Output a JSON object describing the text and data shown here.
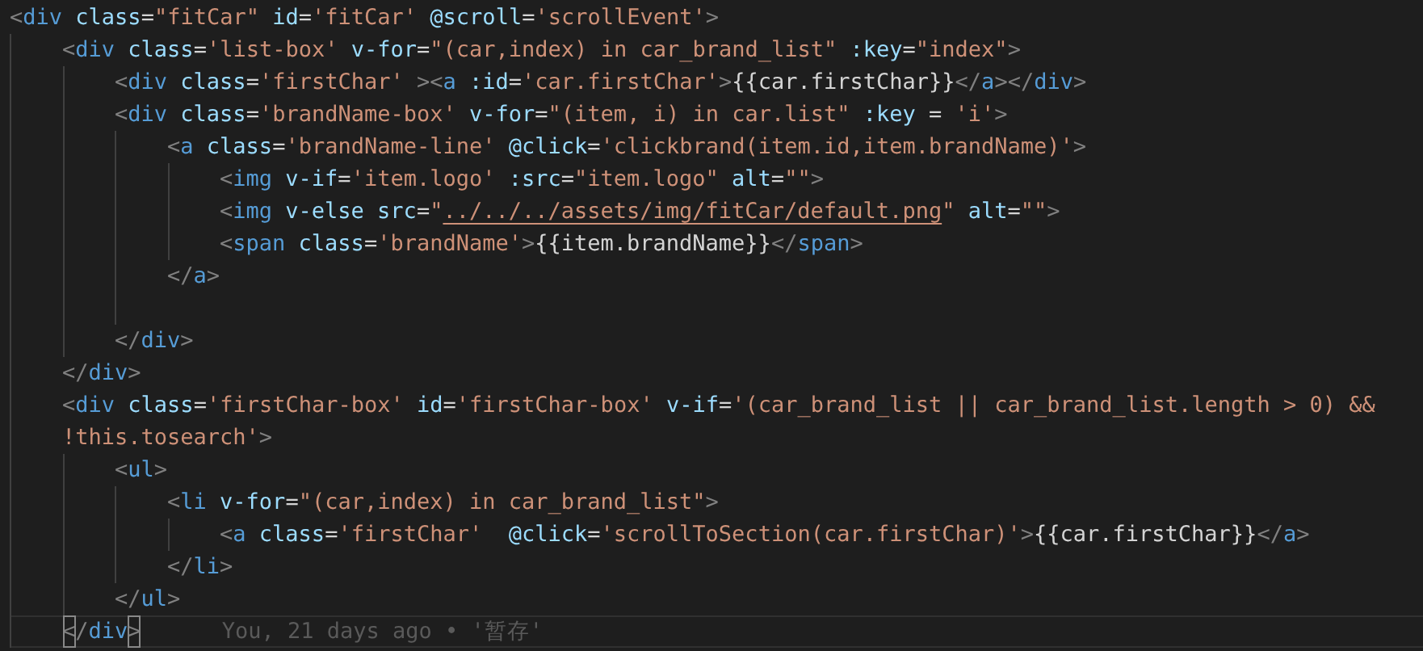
{
  "editor": {
    "lines": [
      {
        "tokens": [
          {
            "kind": "punct",
            "text": "<"
          },
          {
            "kind": "tag",
            "text": "div"
          },
          {
            "kind": "attr",
            "text": " class"
          },
          {
            "kind": "text",
            "text": "="
          },
          {
            "kind": "string",
            "text": "\"fitCar\""
          },
          {
            "kind": "attr",
            "text": " id"
          },
          {
            "kind": "text",
            "text": "="
          },
          {
            "kind": "string",
            "text": "'fitCar'"
          },
          {
            "kind": "attr",
            "text": " @scroll"
          },
          {
            "kind": "text",
            "text": "="
          },
          {
            "kind": "string",
            "text": "'scrollEvent'"
          },
          {
            "kind": "punct",
            "text": ">"
          }
        ],
        "children": [
          {
            "tokens": [
              {
                "kind": "punct",
                "text": "<"
              },
              {
                "kind": "tag",
                "text": "div"
              },
              {
                "kind": "attr",
                "text": " class"
              },
              {
                "kind": "text",
                "text": "="
              },
              {
                "kind": "string",
                "text": "'list-box'"
              },
              {
                "kind": "attr",
                "text": " v-for"
              },
              {
                "kind": "text",
                "text": "="
              },
              {
                "kind": "string",
                "text": "\"(car,index) in car_brand_list\""
              },
              {
                "kind": "attr",
                "text": " :key"
              },
              {
                "kind": "text",
                "text": "="
              },
              {
                "kind": "string",
                "text": "\"index\""
              },
              {
                "kind": "punct",
                "text": ">"
              }
            ],
            "children": [
              {
                "tokens": [
                  {
                    "kind": "punct",
                    "text": "<"
                  },
                  {
                    "kind": "tag",
                    "text": "div"
                  },
                  {
                    "kind": "attr",
                    "text": " class"
                  },
                  {
                    "kind": "text",
                    "text": "="
                  },
                  {
                    "kind": "string",
                    "text": "'firstChar'"
                  },
                  {
                    "kind": "punct",
                    "text": " ><"
                  },
                  {
                    "kind": "tag",
                    "text": "a"
                  },
                  {
                    "kind": "attr",
                    "text": " :id"
                  },
                  {
                    "kind": "text",
                    "text": "="
                  },
                  {
                    "kind": "string",
                    "text": "'car.firstChar'"
                  },
                  {
                    "kind": "punct",
                    "text": ">"
                  },
                  {
                    "kind": "text",
                    "text": "{{car.firstChar}}"
                  },
                  {
                    "kind": "punct",
                    "text": "</"
                  },
                  {
                    "kind": "tag",
                    "text": "a"
                  },
                  {
                    "kind": "punct",
                    "text": "></"
                  },
                  {
                    "kind": "tag",
                    "text": "div"
                  },
                  {
                    "kind": "punct",
                    "text": ">"
                  }
                ]
              },
              {
                "tokens": [
                  {
                    "kind": "punct",
                    "text": "<"
                  },
                  {
                    "kind": "tag",
                    "text": "div"
                  },
                  {
                    "kind": "attr",
                    "text": " class"
                  },
                  {
                    "kind": "text",
                    "text": "="
                  },
                  {
                    "kind": "string",
                    "text": "'brandName-box'"
                  },
                  {
                    "kind": "attr",
                    "text": " v-for"
                  },
                  {
                    "kind": "text",
                    "text": "="
                  },
                  {
                    "kind": "string",
                    "text": "\"(item, i) in car.list\""
                  },
                  {
                    "kind": "attr",
                    "text": " :key"
                  },
                  {
                    "kind": "text",
                    "text": " = "
                  },
                  {
                    "kind": "string",
                    "text": "'i'"
                  },
                  {
                    "kind": "punct",
                    "text": ">"
                  }
                ],
                "children": [
                  {
                    "tokens": [
                      {
                        "kind": "punct",
                        "text": "<"
                      },
                      {
                        "kind": "tag",
                        "text": "a"
                      },
                      {
                        "kind": "attr",
                        "text": " class"
                      },
                      {
                        "kind": "text",
                        "text": "="
                      },
                      {
                        "kind": "string",
                        "text": "'brandName-line'"
                      },
                      {
                        "kind": "attr",
                        "text": " @click"
                      },
                      {
                        "kind": "text",
                        "text": "="
                      },
                      {
                        "kind": "string",
                        "text": "'clickbrand(item.id,item.brandName)'"
                      },
                      {
                        "kind": "punct",
                        "text": ">"
                      }
                    ],
                    "children": [
                      {
                        "tokens": [
                          {
                            "kind": "punct",
                            "text": "<"
                          },
                          {
                            "kind": "tag",
                            "text": "img"
                          },
                          {
                            "kind": "attr",
                            "text": " v-if"
                          },
                          {
                            "kind": "text",
                            "text": "="
                          },
                          {
                            "kind": "string",
                            "text": "'item.logo'"
                          },
                          {
                            "kind": "attr",
                            "text": " :src"
                          },
                          {
                            "kind": "text",
                            "text": "="
                          },
                          {
                            "kind": "string",
                            "text": "\"item.logo\""
                          },
                          {
                            "kind": "attr",
                            "text": " alt"
                          },
                          {
                            "kind": "text",
                            "text": "="
                          },
                          {
                            "kind": "string",
                            "text": "\"\""
                          },
                          {
                            "kind": "punct",
                            "text": ">"
                          }
                        ]
                      },
                      {
                        "tokens": [
                          {
                            "kind": "punct",
                            "text": "<"
                          },
                          {
                            "kind": "tag",
                            "text": "img"
                          },
                          {
                            "kind": "attr",
                            "text": " v-else src"
                          },
                          {
                            "kind": "text",
                            "text": "="
                          },
                          {
                            "kind": "string",
                            "text": "\""
                          },
                          {
                            "kind": "string",
                            "text": "../../../assets/img/fitCar/default.png",
                            "underlined": true
                          },
                          {
                            "kind": "string",
                            "text": "\""
                          },
                          {
                            "kind": "attr",
                            "text": " alt"
                          },
                          {
                            "kind": "text",
                            "text": "="
                          },
                          {
                            "kind": "string",
                            "text": "\"\""
                          },
                          {
                            "kind": "punct",
                            "text": ">"
                          }
                        ]
                      },
                      {
                        "tokens": [
                          {
                            "kind": "punct",
                            "text": "<"
                          },
                          {
                            "kind": "tag",
                            "text": "span"
                          },
                          {
                            "kind": "attr",
                            "text": " class"
                          },
                          {
                            "kind": "text",
                            "text": "="
                          },
                          {
                            "kind": "string",
                            "text": "'brandName'"
                          },
                          {
                            "kind": "punct",
                            "text": ">"
                          },
                          {
                            "kind": "text",
                            "text": "{{item.brandName}}"
                          },
                          {
                            "kind": "punct",
                            "text": "</"
                          },
                          {
                            "kind": "tag",
                            "text": "span"
                          },
                          {
                            "kind": "punct",
                            "text": ">"
                          }
                        ]
                      }
                    ]
                  },
                  {
                    "tokens": [
                      {
                        "kind": "punct",
                        "text": "</"
                      },
                      {
                        "kind": "tag",
                        "text": "a"
                      },
                      {
                        "kind": "punct",
                        "text": ">"
                      }
                    ]
                  },
                  {
                    "blank": true
                  }
                ]
              },
              {
                "tokens": [
                  {
                    "kind": "punct",
                    "text": "</"
                  },
                  {
                    "kind": "tag",
                    "text": "div"
                  },
                  {
                    "kind": "punct",
                    "text": ">"
                  }
                ]
              }
            ]
          },
          {
            "tokens": [
              {
                "kind": "punct",
                "text": "</"
              },
              {
                "kind": "tag",
                "text": "div"
              },
              {
                "kind": "punct",
                "text": ">"
              }
            ]
          },
          {
            "tokens": [
              {
                "kind": "punct",
                "text": "<"
              },
              {
                "kind": "tag",
                "text": "div"
              },
              {
                "kind": "attr",
                "text": " class"
              },
              {
                "kind": "text",
                "text": "="
              },
              {
                "kind": "string",
                "text": "'firstChar-box'"
              },
              {
                "kind": "attr",
                "text": " id"
              },
              {
                "kind": "text",
                "text": "="
              },
              {
                "kind": "string",
                "text": "'firstChar-box'"
              },
              {
                "kind": "attr",
                "text": " v-if"
              },
              {
                "kind": "text",
                "text": "="
              },
              {
                "kind": "string",
                "text": "'(car_brand_list || car_brand_list.length > 0) &&"
              }
            ]
          },
          {
            "tokens": [
              {
                "kind": "string",
                "text": "!this.tosearch'"
              },
              {
                "kind": "punct",
                "text": ">"
              }
            ],
            "children": [
              {
                "tokens": [
                  {
                    "kind": "punct",
                    "text": "<"
                  },
                  {
                    "kind": "tag",
                    "text": "ul"
                  },
                  {
                    "kind": "punct",
                    "text": ">"
                  }
                ],
                "children": [
                  {
                    "tokens": [
                      {
                        "kind": "punct",
                        "text": "<"
                      },
                      {
                        "kind": "tag",
                        "text": "li"
                      },
                      {
                        "kind": "attr",
                        "text": " v-for"
                      },
                      {
                        "kind": "text",
                        "text": "="
                      },
                      {
                        "kind": "string",
                        "text": "\"(car,index) in car_brand_list\""
                      },
                      {
                        "kind": "punct",
                        "text": ">"
                      }
                    ],
                    "children": [
                      {
                        "tokens": [
                          {
                            "kind": "punct",
                            "text": "<"
                          },
                          {
                            "kind": "tag",
                            "text": "a"
                          },
                          {
                            "kind": "attr",
                            "text": " class"
                          },
                          {
                            "kind": "text",
                            "text": "="
                          },
                          {
                            "kind": "string",
                            "text": "'firstChar'"
                          },
                          {
                            "kind": "attr",
                            "text": "  @click"
                          },
                          {
                            "kind": "text",
                            "text": "="
                          },
                          {
                            "kind": "string",
                            "text": "'scrollToSection(car.firstChar)'"
                          },
                          {
                            "kind": "punct",
                            "text": ">"
                          },
                          {
                            "kind": "text",
                            "text": "{{car.firstChar}}"
                          },
                          {
                            "kind": "punct",
                            "text": "</"
                          },
                          {
                            "kind": "tag",
                            "text": "a"
                          },
                          {
                            "kind": "punct",
                            "text": ">"
                          }
                        ]
                      }
                    ]
                  },
                  {
                    "tokens": [
                      {
                        "kind": "punct",
                        "text": "</"
                      },
                      {
                        "kind": "tag",
                        "text": "li"
                      },
                      {
                        "kind": "punct",
                        "text": ">"
                      }
                    ]
                  }
                ]
              },
              {
                "tokens": [
                  {
                    "kind": "punct",
                    "text": "</"
                  },
                  {
                    "kind": "tag",
                    "text": "ul"
                  },
                  {
                    "kind": "punct",
                    "text": ">"
                  }
                ]
              }
            ]
          },
          {
            "current": true,
            "blame": "You, 21 days ago • '暂存'",
            "tokens": [
              {
                "kind": "punct",
                "text": "<",
                "matched": true
              },
              {
                "kind": "punct",
                "text": "/"
              },
              {
                "kind": "tag",
                "text": "div"
              },
              {
                "kind": "punct",
                "text": ">",
                "matched": true
              }
            ]
          }
        ]
      }
    ]
  }
}
